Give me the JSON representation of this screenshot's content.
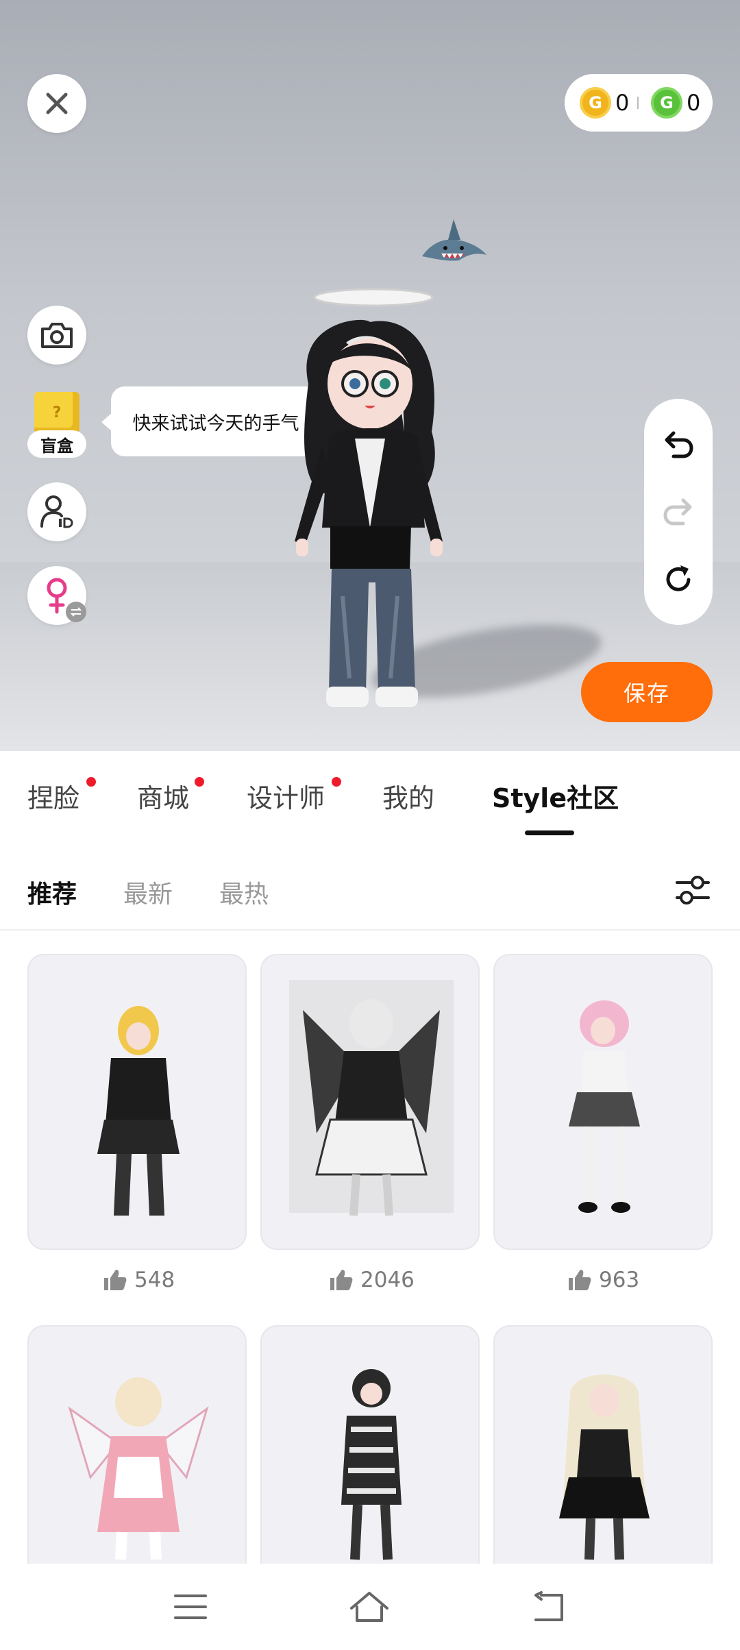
{
  "stage": {
    "tooltip": "快来试试今天的手气",
    "blind_box_label": "盲盒",
    "save_label": "保存",
    "currency": {
      "gold": "0",
      "green": "0"
    }
  },
  "tabs": [
    {
      "label": "捏脸",
      "badge": true
    },
    {
      "label": "商城",
      "badge": true
    },
    {
      "label": "设计师",
      "badge": true
    },
    {
      "label": "我的",
      "badge": false
    },
    {
      "label": "Style社区",
      "badge": false,
      "active": true
    }
  ],
  "subtabs": [
    {
      "label": "推荐",
      "active": true
    },
    {
      "label": "最新"
    },
    {
      "label": "最热"
    }
  ],
  "feed": [
    {
      "likes": "548"
    },
    {
      "likes": "2046"
    },
    {
      "likes": "963"
    },
    {
      "likes": ""
    },
    {
      "likes": ""
    },
    {
      "likes": ""
    }
  ],
  "colors": {
    "accent": "#ff6e0a",
    "badge": "#ef1b2b"
  }
}
